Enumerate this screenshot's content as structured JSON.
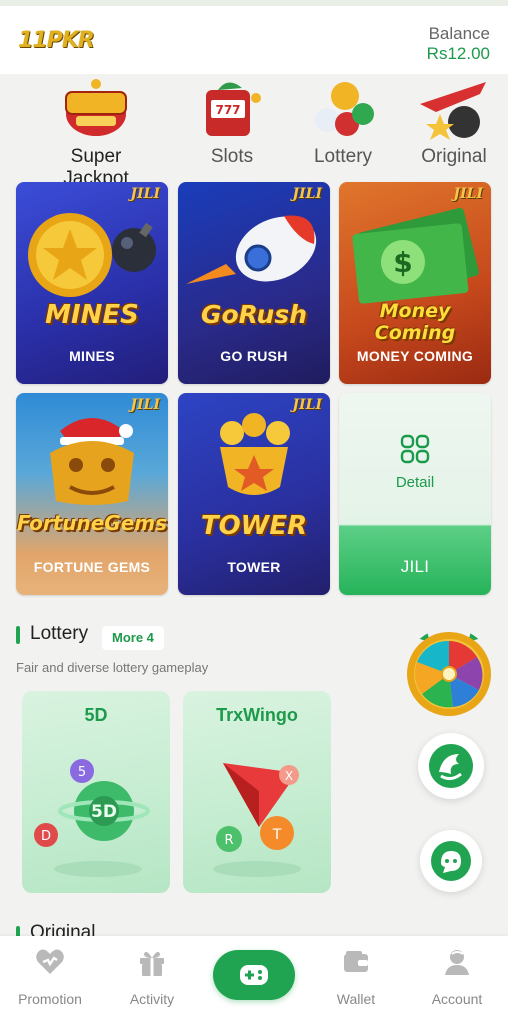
{
  "header": {
    "logo_text": "11PKR",
    "balance_label": "Balance",
    "balance_value": "Rs12.00"
  },
  "categories": [
    {
      "label": "Super Jackpot",
      "icon": "jackpot-icon"
    },
    {
      "label": "Slots",
      "icon": "slot-machine-icon"
    },
    {
      "label": "Lottery",
      "icon": "lottery-balls-icon"
    },
    {
      "label": "Original",
      "icon": "plane-bomb-icon"
    }
  ],
  "games": [
    {
      "title_art": "MINES",
      "name": "MINES",
      "provider": "JILI"
    },
    {
      "title_art": "GoRush",
      "name": "GO RUSH",
      "provider": "JILI"
    },
    {
      "title_art": "Money Coming",
      "name": "MONEY COMING",
      "provider": "JILI"
    },
    {
      "title_art": "FortuneGems",
      "name": "FORTUNE GEMS",
      "provider": "JILI"
    },
    {
      "title_art": "TOWER",
      "name": "TOWER",
      "provider": "JILI"
    }
  ],
  "jili_card": {
    "detail_label": "Detail",
    "name": "JILI"
  },
  "lottery_section": {
    "title": "Lottery",
    "more_label": "More 4",
    "subtitle": "Fair and diverse lottery gameplay",
    "cards": [
      {
        "title": "5D",
        "badge": "5D"
      },
      {
        "title": "TrxWingo"
      }
    ]
  },
  "original_section": {
    "title": "Original"
  },
  "bottom_nav": [
    {
      "label": "Promotion",
      "icon": "promotion-icon"
    },
    {
      "label": "Activity",
      "icon": "gift-icon"
    },
    {
      "label": "",
      "icon": "gamepad-icon"
    },
    {
      "label": "Wallet",
      "icon": "wallet-icon"
    },
    {
      "label": "Account",
      "icon": "account-icon"
    }
  ],
  "colors": {
    "accent": "#21a451",
    "balance": "#1d9a4b",
    "background": "#f2f2f0"
  }
}
